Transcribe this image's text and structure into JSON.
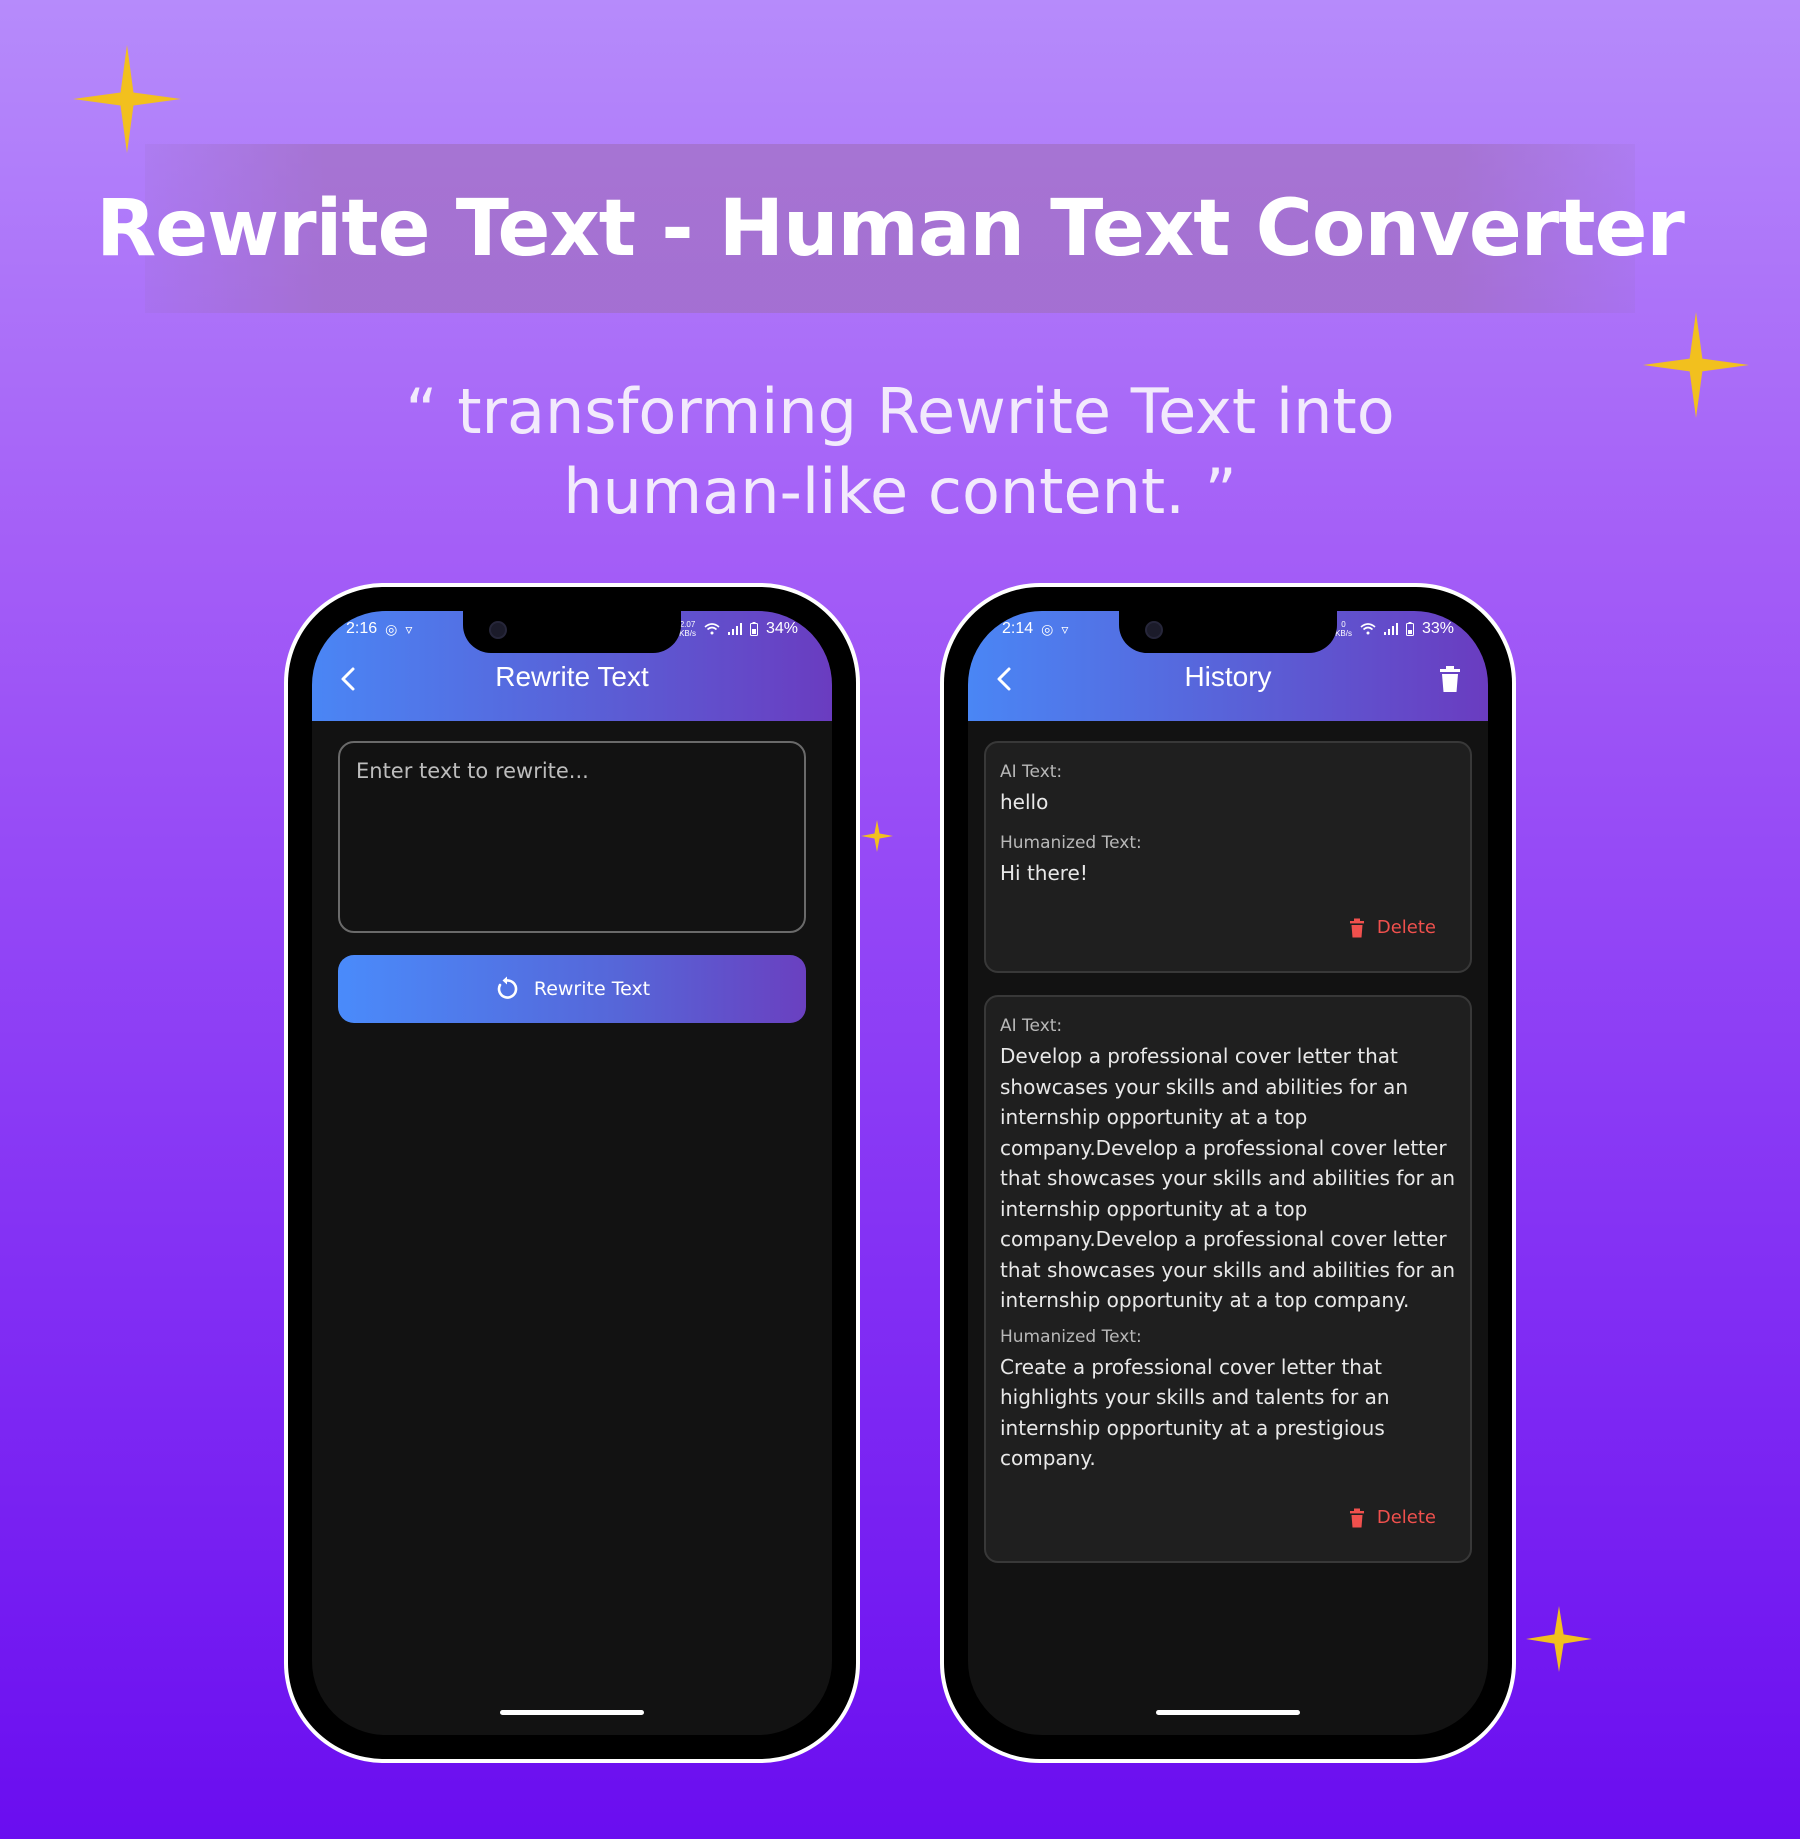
{
  "banner": {
    "title": "Rewrite Text - Human Text Converter"
  },
  "tagline": {
    "line1": "“ transforming Rewrite Text into",
    "line2": "human-like content. ”"
  },
  "colors": {
    "sparkle": "#f2c01e",
    "appbar_start": "#4a86f5",
    "appbar_end": "#6a3cc0",
    "delete": "#f0504d"
  },
  "phone_left": {
    "status": {
      "time": "2:16",
      "speed_value": "2.07",
      "speed_unit": "KB/s",
      "battery": "34%"
    },
    "appbar": {
      "title": "Rewrite Text"
    },
    "input": {
      "placeholder": "Enter text to rewrite..."
    },
    "button": {
      "label": "Rewrite Text",
      "icon": "refresh-icon"
    }
  },
  "phone_right": {
    "status": {
      "time": "2:14",
      "speed_value": "0",
      "speed_unit": "KB/s",
      "battery": "33%"
    },
    "appbar": {
      "title": "History",
      "action_icon": "trash-icon"
    },
    "history": [
      {
        "ai_label": "AI Text:",
        "ai_text": "hello",
        "human_label": "Humanized Text:",
        "human_text": "Hi there!",
        "delete_label": "Delete"
      },
      {
        "ai_label": "AI Text:",
        "ai_text": "Develop a professional cover letter that showcases your skills and abilities for an internship opportunity at a top company.Develop a professional cover letter that showcases your skills and abilities for an internship opportunity at a top company.Develop a professional cover letter that showcases your skills and abilities for an internship opportunity at a top company.",
        "human_label": "Humanized Text:",
        "human_text": "Create a professional cover letter that highlights your skills and talents for an internship opportunity at a prestigious company.",
        "delete_label": "Delete"
      }
    ]
  }
}
